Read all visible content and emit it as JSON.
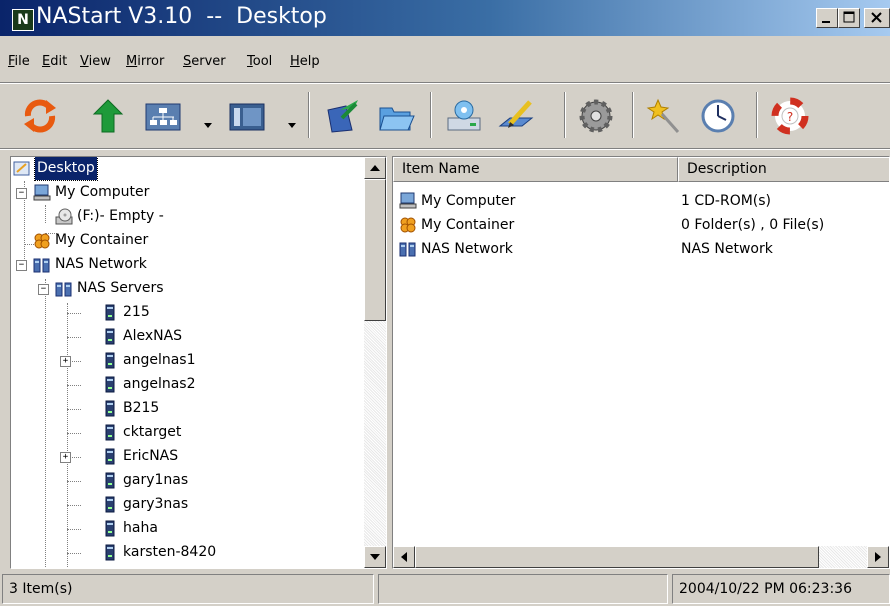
{
  "window": {
    "title": "NAStart V3.10  --  Desktop",
    "app_icon_letter": "N"
  },
  "menu": [
    {
      "pre": "",
      "u": "F",
      "post": "ile"
    },
    {
      "pre": "",
      "u": "E",
      "post": "dit"
    },
    {
      "pre": "",
      "u": "V",
      "post": "iew"
    },
    {
      "pre": "",
      "u": "M",
      "post": "irror"
    },
    {
      "pre": "",
      "u": "S",
      "post": "erver"
    },
    {
      "pre": "",
      "u": "T",
      "post": "ool"
    },
    {
      "pre": "",
      "u": "H",
      "post": "elp"
    }
  ],
  "toolbar": {
    "icons": [
      "refresh-icon",
      "up-arrow-icon",
      "network-view-icon",
      "display-view-icon",
      "export-icon",
      "open-folder-icon",
      "disk-icon",
      "edit-pencil-icon",
      "settings-gear-icon",
      "wizard-wand-icon",
      "clock-icon",
      "help-lifebuoy-icon"
    ]
  },
  "tree": {
    "root": "Desktop",
    "my_computer": "My Computer",
    "cdrom": "(F:)- Empty -",
    "my_container": "My Container",
    "nas_network": "NAS Network",
    "nas_servers": "NAS Servers",
    "servers": [
      "215",
      "AlexNAS",
      "angelnas1",
      "angelnas2",
      "B215",
      "cktarget",
      "EricNAS",
      "gary1nas",
      "gary3nas",
      "haha",
      "karsten-8420"
    ]
  },
  "list": {
    "col_name": "Item Name",
    "col_desc": "Description",
    "rows": [
      {
        "name": "My Computer",
        "desc": "1 CD-ROM(s)"
      },
      {
        "name": "My Container",
        "desc": "0 Folder(s) , 0 File(s)"
      },
      {
        "name": "NAS Network",
        "desc": "NAS Network"
      }
    ]
  },
  "status": {
    "items": "3 Item(s)",
    "middle": "",
    "datetime": "2004/10/22  PM 06:23:36"
  }
}
